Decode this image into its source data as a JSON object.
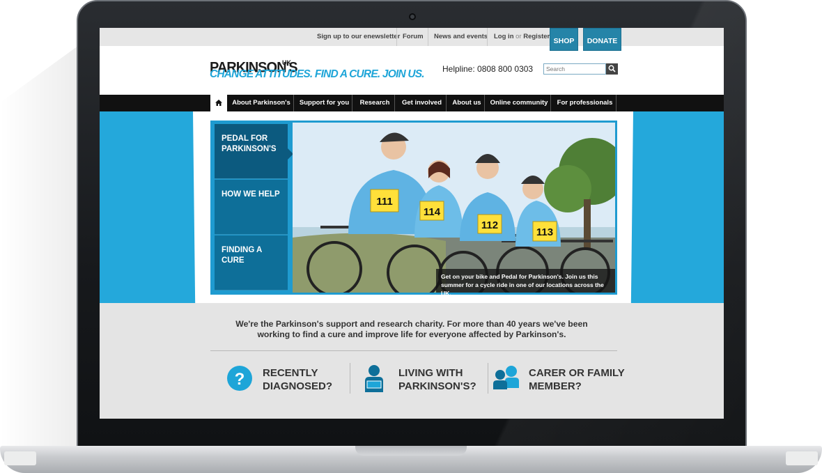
{
  "topbar": {
    "newsletter": "Sign up to our enewsletter",
    "forum": "Forum",
    "news": "News and events",
    "login": "Log in",
    "or": "or",
    "register": "Register",
    "shop": "SHOP",
    "donate": "DONATE"
  },
  "header": {
    "logo_main": "PARKINSON'S",
    "logo_uk": "UK",
    "tagline": "CHANGE ATTITUDES. FIND A CURE. JOIN US.",
    "helpline": "Helpline: 0808 800 0303",
    "search_placeholder": "Search"
  },
  "nav": {
    "home_icon": "home-icon",
    "items": [
      "About Parkinson's",
      "Support for you",
      "Research",
      "Get involved",
      "About us",
      "Online community",
      "For professionals"
    ]
  },
  "hero": {
    "tabs": [
      "PEDAL FOR PARKINSON'S",
      "HOW WE HELP",
      "FINDING A CURE"
    ],
    "active_tab": 0,
    "caption": "Get on your bike and Pedal for Parkinson's. Join us this summer for a cycle ride in one of our locations across the UK.",
    "bib_numbers": [
      "111",
      "114",
      "112",
      "113"
    ]
  },
  "intro": {
    "text": "We're the Parkinson's support and research charity. For more than 40 years we've been working to find a cure and improve life for everyone affected by Parkinson's."
  },
  "audiences": [
    {
      "label_line1": "RECENTLY",
      "label_line2": "DIAGNOSED?",
      "icon": "question-icon"
    },
    {
      "label_line1": "LIVING WITH",
      "label_line2": "PARKINSON'S?",
      "icon": "person-reading-icon"
    },
    {
      "label_line1": "CARER OR FAMILY",
      "label_line2": "MEMBER?",
      "icon": "family-icon"
    }
  ],
  "colors": {
    "accent_blue": "#24a8db",
    "nav_black": "#111111",
    "button_blue": "#2584a8",
    "tab_blue": "#0e6f99"
  }
}
